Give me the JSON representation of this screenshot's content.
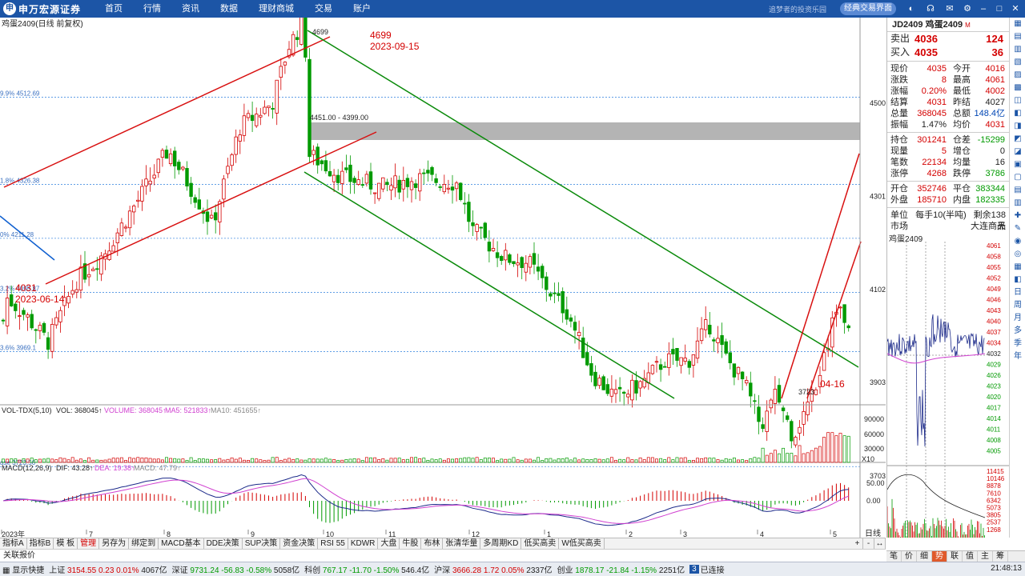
{
  "topbar": {
    "brand": "申万宏源证券",
    "menu": [
      "首页",
      "行情",
      "资讯",
      "数据",
      "理财商城",
      "交易",
      "账户"
    ],
    "slogan": "追梦者的投资乐园",
    "classic_btn": "经典交易界面"
  },
  "chart": {
    "title": "鸡蛋2409(日线 前复权)",
    "fib_labels": [
      {
        "price": 4512.69,
        "text": "9.9% 4512.69"
      },
      {
        "price": 4326.38,
        "text": "1.8% 4326.38"
      },
      {
        "price": 4211.28,
        "text": "0% 4211.28"
      },
      {
        "price": 4095.87,
        "text": "3.2% 4095.87"
      },
      {
        "price": 3969.1,
        "text": "3.6% 3969.1"
      },
      {
        "price": 3723.56,
        "text": "ase 3723.56"
      }
    ],
    "annotations": {
      "high_price": "4699",
      "high_date": "2023-09-15",
      "low_price": "4031",
      "low_date": "2023-06-14",
      "gap_label": "4451.00 - 4399.00",
      "recent_low": "3723",
      "recent_date": "04-16",
      "peak_marker": "4699"
    },
    "price_axis": [
      "4500",
      "4301",
      "4102",
      "3903",
      "3703"
    ],
    "vol_indicator": {
      "name": "VOL-TDX(5,10)",
      "vol": "VOL: 368045↑",
      "volume": "VOLUME: 368045↑",
      "ma5": "MA5: 521833↑",
      "ma10": "MA10: 451655↑",
      "axis": [
        "90000",
        "60000",
        "30000"
      ],
      "unit": "X10"
    },
    "macd_indicator": {
      "name": "MACD(12,26,9)",
      "dif": "DIF: 43.28↑",
      "dea": "DEA: 19.38↑",
      "macd": "MACD: 47.79↑",
      "axis": [
        "50.00",
        "0.00"
      ]
    },
    "x_axis": [
      "2023年",
      "7",
      "8",
      "9",
      "10",
      "11",
      "12",
      "1",
      "2",
      "3",
      "4",
      "5"
    ]
  },
  "right_panel": {
    "title": "JD2409 鸡蛋2409",
    "title_mark": "M",
    "sell": {
      "label": "卖出",
      "price": "4036",
      "vol": "124"
    },
    "buy": {
      "label": "买入",
      "price": "4035",
      "vol": "36"
    },
    "rows1": [
      [
        "现价",
        "4035",
        "今开",
        "4016"
      ],
      [
        "涨跌",
        "8",
        "最高",
        "4061"
      ],
      [
        "涨幅",
        "0.20%",
        "最低",
        "4002"
      ],
      [
        "结算",
        "4031",
        "昨结",
        "4027"
      ],
      [
        "总量",
        "368045",
        "总额",
        "148.4亿"
      ],
      [
        "振幅",
        "1.47%",
        "均价",
        "4031"
      ]
    ],
    "rows2": [
      [
        "持仓",
        "301241",
        "仓差",
        "-15299"
      ],
      [
        "现量",
        "5",
        "增仓",
        "0"
      ],
      [
        "笔数",
        "22134",
        "均量",
        "16"
      ],
      [
        "涨停",
        "4268",
        "跌停",
        "3786"
      ]
    ],
    "rows3": [
      [
        "开仓",
        "352746",
        "平仓",
        "383344"
      ],
      [
        "外盘",
        "185710",
        "内盘",
        "182335"
      ]
    ],
    "unit_label": "单位",
    "unit_value": "每手10(半吨)",
    "remain": "剩余138天",
    "market_label": "市场",
    "market_value": "大连商品",
    "mini_title": "鸡蛋2409",
    "mini_axis": [
      "4061",
      "4058",
      "4055",
      "4052",
      "4049",
      "4046",
      "4043",
      "4040",
      "4037",
      "4034",
      "4032",
      "4029",
      "4026",
      "4023",
      "4020",
      "4017",
      "4014",
      "4011",
      "4008",
      "4005",
      "11415",
      "10146",
      "8878",
      "7610",
      "6342",
      "5073",
      "3805",
      "2537",
      "1268"
    ]
  },
  "side_icons": [
    "▦",
    "▤",
    "▥",
    "▧",
    "▨",
    "▩",
    "◫",
    "◧",
    "◨",
    "◩",
    "◪",
    "▣",
    "▢",
    "▤",
    "▥",
    "✚",
    "✎",
    "◉",
    "◎",
    "▦",
    "◧",
    "日",
    "周",
    "月",
    "多",
    "季",
    "年"
  ],
  "tabs": [
    "指标A",
    "指标B",
    "模 板",
    "管理",
    "另存为",
    "绑定到",
    "MACD基本",
    "DDE决策",
    "SUP决策",
    "资金决策",
    "RSI 55",
    "KDWR",
    "大盘",
    "牛股",
    "布林",
    "张清华量",
    "多周期KD",
    "低买高卖",
    "W低买高卖"
  ],
  "active_tab": "管理",
  "nav_buttons": [
    "+",
    "-",
    "↔"
  ],
  "period_label": "日线",
  "right_tabs": [
    "笔",
    "价",
    "细",
    "势",
    "联",
    "值",
    "主",
    "筹"
  ],
  "right_active": "势",
  "subbar": "关联报价",
  "status": {
    "start": "显示快捷",
    "items": [
      {
        "name": "上证",
        "price": "3154.55",
        "chg": "0.23",
        "pct": "0.01%",
        "amt": "4067亿"
      },
      {
        "name": "深证",
        "price": "9731.24",
        "chg": "-56.83",
        "pct": "-0.58%",
        "amt": "5058亿"
      },
      {
        "name": "科创",
        "price": "767.17",
        "chg": "-11.70",
        "pct": "-1.50%",
        "amt": "546.4亿"
      },
      {
        "name": "沪深",
        "price": "3666.28",
        "chg": "1.72",
        "pct": "0.05%",
        "amt": "2337亿"
      },
      {
        "name": "创业",
        "price": "1878.17",
        "chg": "-21.84",
        "pct": "-1.15%",
        "amt": "2251亿"
      }
    ],
    "conn_num": "3",
    "conn": "已连接",
    "time": "21:48:13"
  },
  "colors": {
    "up": "#d40000",
    "down": "#009a00",
    "topbar": "#1c55a6",
    "trend_red": "#d81010",
    "trend_green": "#0a8a0a",
    "gap": "#b4b4b4"
  }
}
